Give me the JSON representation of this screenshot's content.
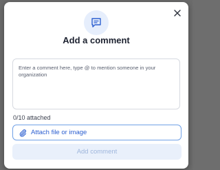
{
  "dialog": {
    "title": "Add a comment",
    "comment_placeholder": "Enter a comment here, type @ to mention someone in your organization",
    "attachment_count": "0/10 attached",
    "attach_label": "Attach file or image",
    "submit_label": "Add comment"
  },
  "colors": {
    "accent": "#2c5fd0",
    "accent_border": "#6fa0e6",
    "disabled_bg": "#e9f0fb",
    "disabled_text": "#9fb6dc",
    "icon_bg": "#e6eefc"
  },
  "icons": {
    "close": "close-icon",
    "hero": "comment-icon",
    "attach": "paperclip-icon"
  }
}
